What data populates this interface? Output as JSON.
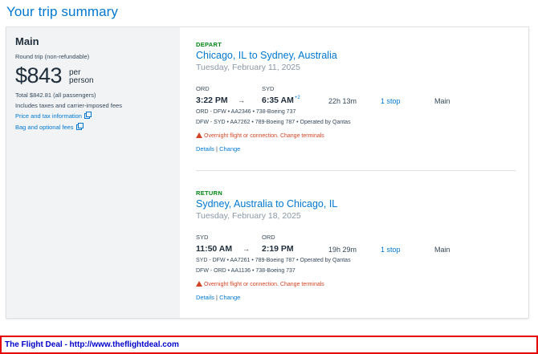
{
  "page": {
    "title": "Your trip summary"
  },
  "summary": {
    "cabin": "Main",
    "trip_type": "Round trip (non-refundable)",
    "price": "$843",
    "per_person": "per person",
    "total": "Total $842.81 (all passengers)",
    "includes": "Includes taxes and carrier-imposed fees",
    "price_tax_link": "Price and tax information",
    "bag_fees_link": "Bag and optional fees"
  },
  "legs": [
    {
      "label": "DEPART",
      "route": "Chicago, IL to Sydney, Australia",
      "date": "Tuesday, February 11, 2025",
      "origin_code": "ORD",
      "destination_code": "SYD",
      "depart_time": "3:22 PM",
      "arrive_time": "6:35 AM",
      "day_offset": "+2",
      "duration": "22h 13m",
      "stops": "1 stop",
      "cabin": "Main",
      "segments": [
        "ORD - DFW • AA2346 • 738-Boeing 737",
        "DFW - SYD • AA7262 • 789-Boeing 787 • Operated by Qantas"
      ],
      "warning": "Overnight flight or connection. Change terminals",
      "details_label": "Details",
      "separator": "|",
      "change_label": "Change"
    },
    {
      "label": "RETURN",
      "route": "Sydney, Australia to Chicago, IL",
      "date": "Tuesday, February 18, 2025",
      "origin_code": "SYD",
      "destination_code": "ORD",
      "depart_time": "11:50 AM",
      "arrive_time": "2:19 PM",
      "day_offset": "",
      "duration": "19h 29m",
      "stops": "1 stop",
      "cabin": "Main",
      "segments": [
        "SYD - DFW • AA7261 • 789-Boeing 787 • Operated by Qantas",
        "DFW - ORD • AA1136 • 738-Boeing 737"
      ],
      "warning": "Overnight flight or connection. Change terminals",
      "details_label": "Details",
      "separator": "|",
      "change_label": "Change"
    }
  ],
  "arrow_glyph": "→",
  "footer": {
    "text": "The Flight Deal - http://www.theflightdeal.com"
  },
  "colors": {
    "accent": "#0078d2",
    "depart_label": "#008712",
    "warning": "#d14424",
    "footer_border": "#e60000",
    "footer_text": "#0000cc"
  }
}
